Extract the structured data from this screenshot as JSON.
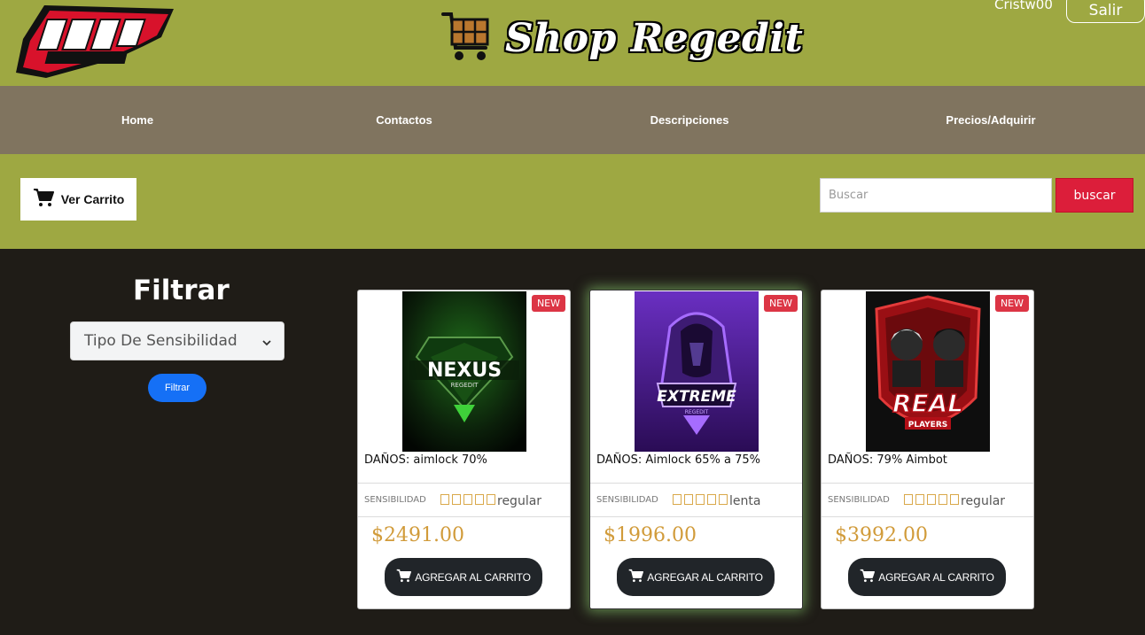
{
  "header": {
    "brand_title": "Shop Regedit",
    "user_name": "Cristw00",
    "logout_label": "Salir",
    "logo_text": "FULL REGEDIT"
  },
  "nav": {
    "items": [
      {
        "label": "Home"
      },
      {
        "label": "Contactos"
      },
      {
        "label": "Descripciones"
      },
      {
        "label": "Precios/Adquirir"
      }
    ]
  },
  "toolbar": {
    "cart_label": "Ver Carrito",
    "search_placeholder": "Buscar",
    "search_button": "buscar"
  },
  "filter": {
    "title": "Filtrar",
    "select_value": "Tipo De Sensibilidad",
    "button_label": "Filtrar"
  },
  "products": [
    {
      "badge": "NEW",
      "title": "DAÑOS: aimlock 70%",
      "sens_label": "SENSIBILIDAD",
      "sens_value": "regular",
      "price": "$2491.00",
      "add_label": "AGREGAR AL CARRITO",
      "image": "Nexus Regedit logo"
    },
    {
      "badge": "NEW",
      "title": "DAÑOS: Aimlock 65% a 75%",
      "sens_label": "SENSIBILIDAD",
      "sens_value": "lenta",
      "price": "$1996.00",
      "add_label": "AGREGAR AL CARRITO",
      "image": "Extreme Regedit logo"
    },
    {
      "badge": "NEW",
      "title": "DAÑOS: 79% Aimbot",
      "sens_label": "SENSIBILIDAD",
      "sens_value": "regular",
      "price": "$3992.00",
      "add_label": "AGREGAR AL CARRITO",
      "image": "Real Players logo"
    }
  ],
  "colors": {
    "header_bg": "#9ea842",
    "nav_bg": "#80745f",
    "page_bg": "#1f1c17",
    "search_button": "#dc1e3a",
    "filter_button": "#1570f6",
    "price": "#d19b3a",
    "badge": "#dc3545"
  }
}
